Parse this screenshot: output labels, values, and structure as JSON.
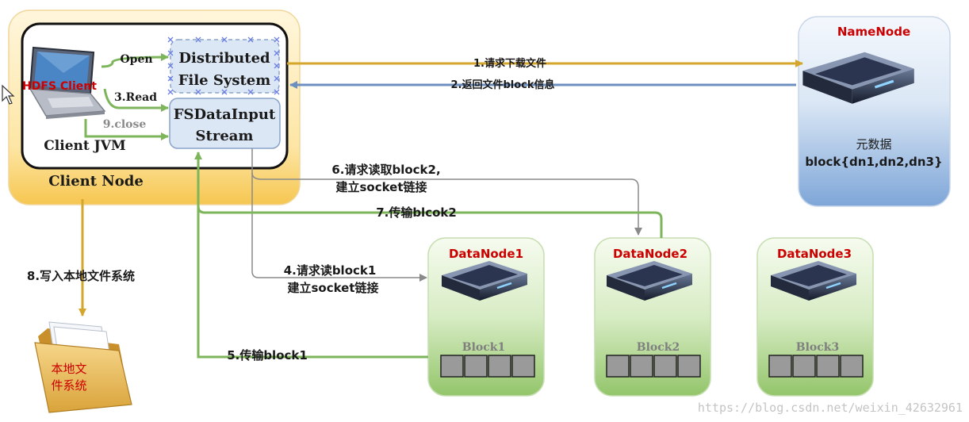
{
  "client_node": {
    "label": "Client Node",
    "jvm_label": "Client JVM",
    "hdfs_client_label": "HDFS Client",
    "dfs_line1": "Distributed",
    "dfs_line2": "File System",
    "fsdis_line1": "FSDataInput",
    "fsdis_line2": "Stream",
    "open_label": "Open",
    "read_label": "3.Read",
    "close_label": "9.close"
  },
  "namenode": {
    "title": "NameNode",
    "meta_line1": "元数据",
    "meta_line2": "block{dn1,dn2,dn3}"
  },
  "datanodes": [
    {
      "title": "DataNode1",
      "block_label": "Block1"
    },
    {
      "title": "DataNode2",
      "block_label": "Block2"
    },
    {
      "title": "DataNode3",
      "block_label": "Block3"
    }
  ],
  "steps": {
    "s1": "1.请求下载文件",
    "s2": "2.返回文件block信息",
    "s4_line1": "4.请求读block1",
    "s4_line2": "建立socket链接",
    "s5": "5.传输block1",
    "s6_line1": "6.请求读取block2,",
    "s6_line2": "建立socket链接",
    "s7": "7.传输blcok2",
    "s8": "8.写入本地文件系统"
  },
  "local_fs": {
    "line1": "本地文",
    "line2": "件系统"
  },
  "watermark": "https://blog.csdn.net/weixin_42632961",
  "colors": {
    "gold": "#d4a72c",
    "green": "#7db55a",
    "blue_arrow": "#6d8fbf",
    "gray_arrow": "#8a8a8a",
    "red_title": "#cc0000"
  }
}
